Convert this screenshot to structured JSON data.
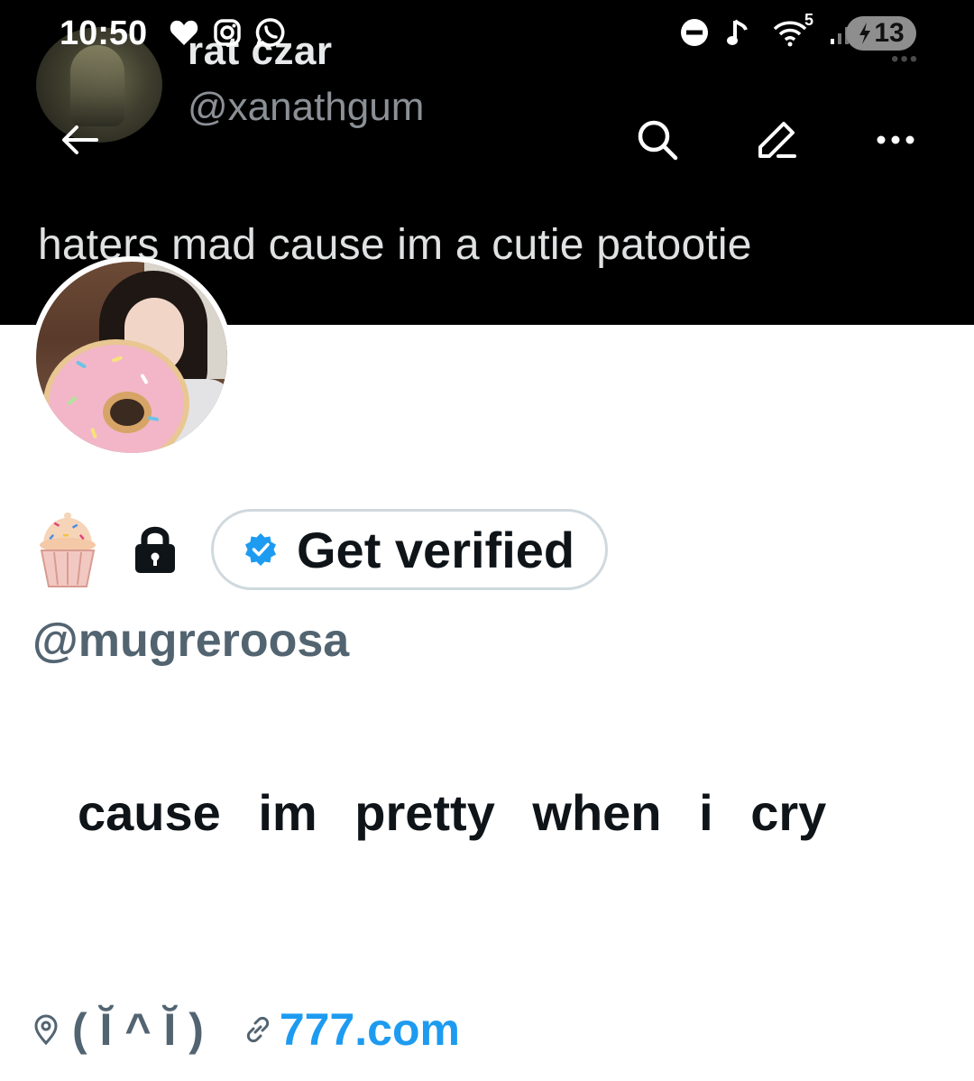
{
  "status_bar": {
    "time": "10:50",
    "network_label": "5",
    "battery_percent": "13",
    "left_icons": [
      "heart-icon",
      "instagram-icon",
      "whatsapp-icon"
    ],
    "right_icons": [
      "do-not-disturb-icon",
      "music-note-icon",
      "wifi-icon",
      "signal-icon",
      "battery-charging-icon"
    ]
  },
  "banner": {
    "name": "rat czar",
    "handle": "@xanathgum",
    "tweet_text": "haters mad cause im a cutie patootie"
  },
  "nav": {
    "icons": [
      "back-arrow-icon",
      "search-icon",
      "edit-icon",
      "more-icon"
    ]
  },
  "profile": {
    "name_emoji": [
      "cupcake-icon",
      "lock-icon"
    ],
    "verify_label": "Get verified",
    "handle": "@mugreroosa",
    "bio": "cause im pretty when i cry",
    "location": "( Ĭ ^ Ĭ )",
    "link": "777.com"
  },
  "colors": {
    "banner_bg": "#000000",
    "text_primary": "#0f1419",
    "text_secondary": "#536471",
    "accent": "#1d9bf0",
    "button_border": "#cfd9de"
  }
}
